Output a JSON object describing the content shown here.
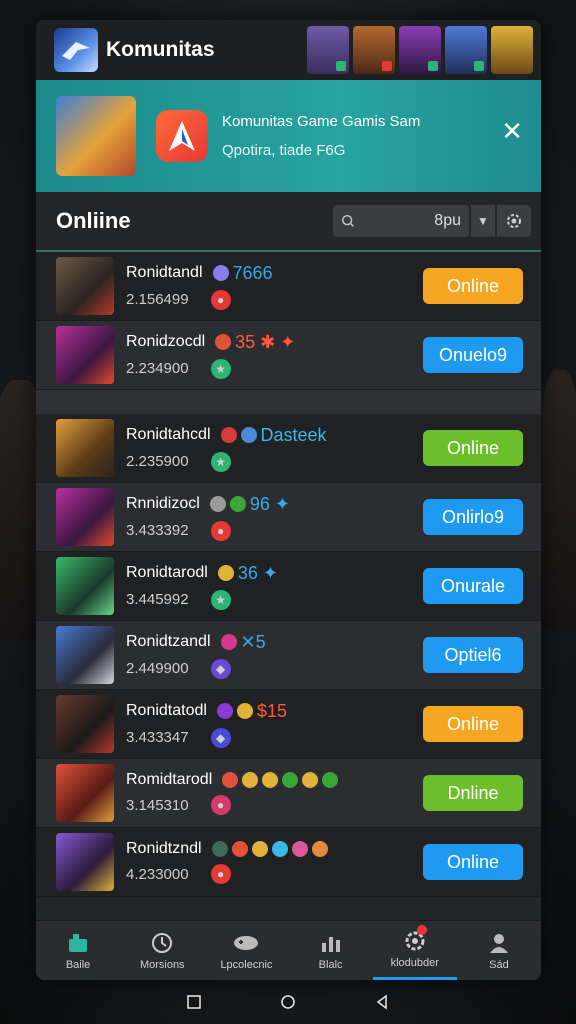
{
  "app": {
    "title": "Komunitas"
  },
  "banner": {
    "title": "Komunitas Game Gamis Sam",
    "subtitle": "Qpotira, tiade F6G",
    "close": "✕"
  },
  "section": {
    "title": "Onliine",
    "search_value": "8pu"
  },
  "players": [
    {
      "name": "Ronidtandl",
      "score": "2.156499",
      "tag": "7666",
      "tag_color": "#3aa6e8",
      "button": "Online",
      "button_style": "orange"
    },
    {
      "name": "Ronidzocdl",
      "score": "2.234900",
      "tag": "35 ✱ ✦",
      "tag_color": "#ff5a3c",
      "button": "Onuelo9",
      "button_style": "blue"
    },
    {
      "name": "Ronidtahcdl",
      "score": "2.235900",
      "tag": "Dasteek",
      "tag_color": "#3ab8e8",
      "button": "Online",
      "button_style": "green"
    },
    {
      "name": "Rnnidizocl",
      "score": "3.433392",
      "tag": "96 ✦",
      "tag_color": "#3aa6e8",
      "button": "Onlirlo9",
      "button_style": "blue"
    },
    {
      "name": "Ronidtarodl",
      "score": "3.445992",
      "tag": "36 ✦",
      "tag_color": "#3aa6e8",
      "button": "Onurale",
      "button_style": "blue"
    },
    {
      "name": "Ronidtzandl",
      "score": "2.449900",
      "tag": "✕5",
      "tag_color": "#3aa6e8",
      "button": "Optiel6",
      "button_style": "blue"
    },
    {
      "name": "Ronidtatodl",
      "score": "3.433347",
      "tag": "$15",
      "tag_color": "#ff5a3c",
      "button": "Online",
      "button_style": "orange"
    },
    {
      "name": "Romidtarodl",
      "score": "3.145310",
      "tag": "",
      "tag_color": "#ffffff",
      "button": "Dnline",
      "button_style": "green"
    },
    {
      "name": "Ronidtzndl",
      "score": "4.233000",
      "tag": "",
      "tag_color": "#ffffff",
      "button": "Online",
      "button_style": "blue"
    }
  ],
  "nav": [
    {
      "label": "Baile",
      "icon": "home-icon"
    },
    {
      "label": "Morsions",
      "icon": "clock-icon"
    },
    {
      "label": "Lpcolecnic",
      "icon": "controller-icon"
    },
    {
      "label": "Blalc",
      "icon": "stats-icon"
    },
    {
      "label": "klodubder",
      "icon": "gear-icon"
    },
    {
      "label": "Sád",
      "icon": "profile-icon"
    }
  ],
  "colors": {
    "accent": "#1e9bf0",
    "orange": "#f5a623",
    "green": "#6cbf2a",
    "banner": "#27a3a0"
  }
}
